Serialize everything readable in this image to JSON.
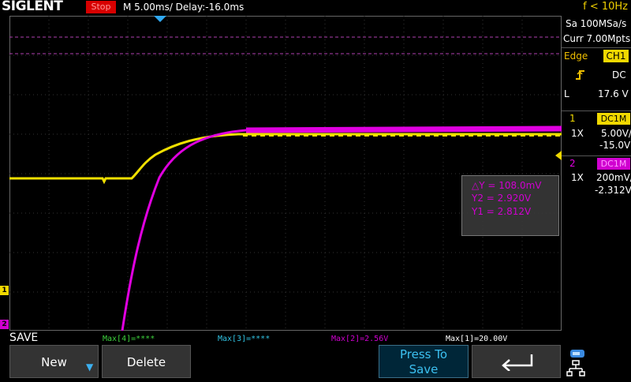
{
  "header": {
    "logo": "SIGLENT",
    "run_status": "Stop",
    "timebase": "M 5.00ms/ Delay:-16.0ms",
    "freq": "f < 10Hz"
  },
  "acquisition": {
    "sample_rate": "Sa 100MSa/s",
    "memory": "Curr 7.00Mpts"
  },
  "trigger": {
    "type": "Edge",
    "source": "CH1",
    "coupling": "DC",
    "level_label": "L",
    "level": "17.6 V"
  },
  "channels": [
    {
      "num": "1",
      "coupling": "DC1M",
      "probe": "1X",
      "scale": "5.00V/",
      "offset": "-15.0V",
      "color": "#f0d800"
    },
    {
      "num": "2",
      "coupling": "DC1M",
      "probe": "1X",
      "scale": "200mV/",
      "offset": "-2.312V",
      "color": "#d000d0"
    }
  ],
  "cursors": {
    "dy": "△Y = 108.0mV",
    "y2": "Y2 = 2.920V",
    "y1": "Y1 = 2.812V"
  },
  "markers": {
    "ch1": "1",
    "ch2": "2"
  },
  "measurements": {
    "m4": "Max[4]=****",
    "m3": "Max[3]=****",
    "m2": "Max[2]=2.56V",
    "m1": "Max[1]=20.00V"
  },
  "menu": {
    "title": "SAVE",
    "new": "New",
    "delete": "Delete",
    "press_to_save_line1": "Press To",
    "press_to_save_line2": "Save"
  },
  "icons": {
    "back": "back-arrow-icon",
    "usb": "usb-icon",
    "network": "network-icon",
    "slope": "rising-edge-icon"
  }
}
